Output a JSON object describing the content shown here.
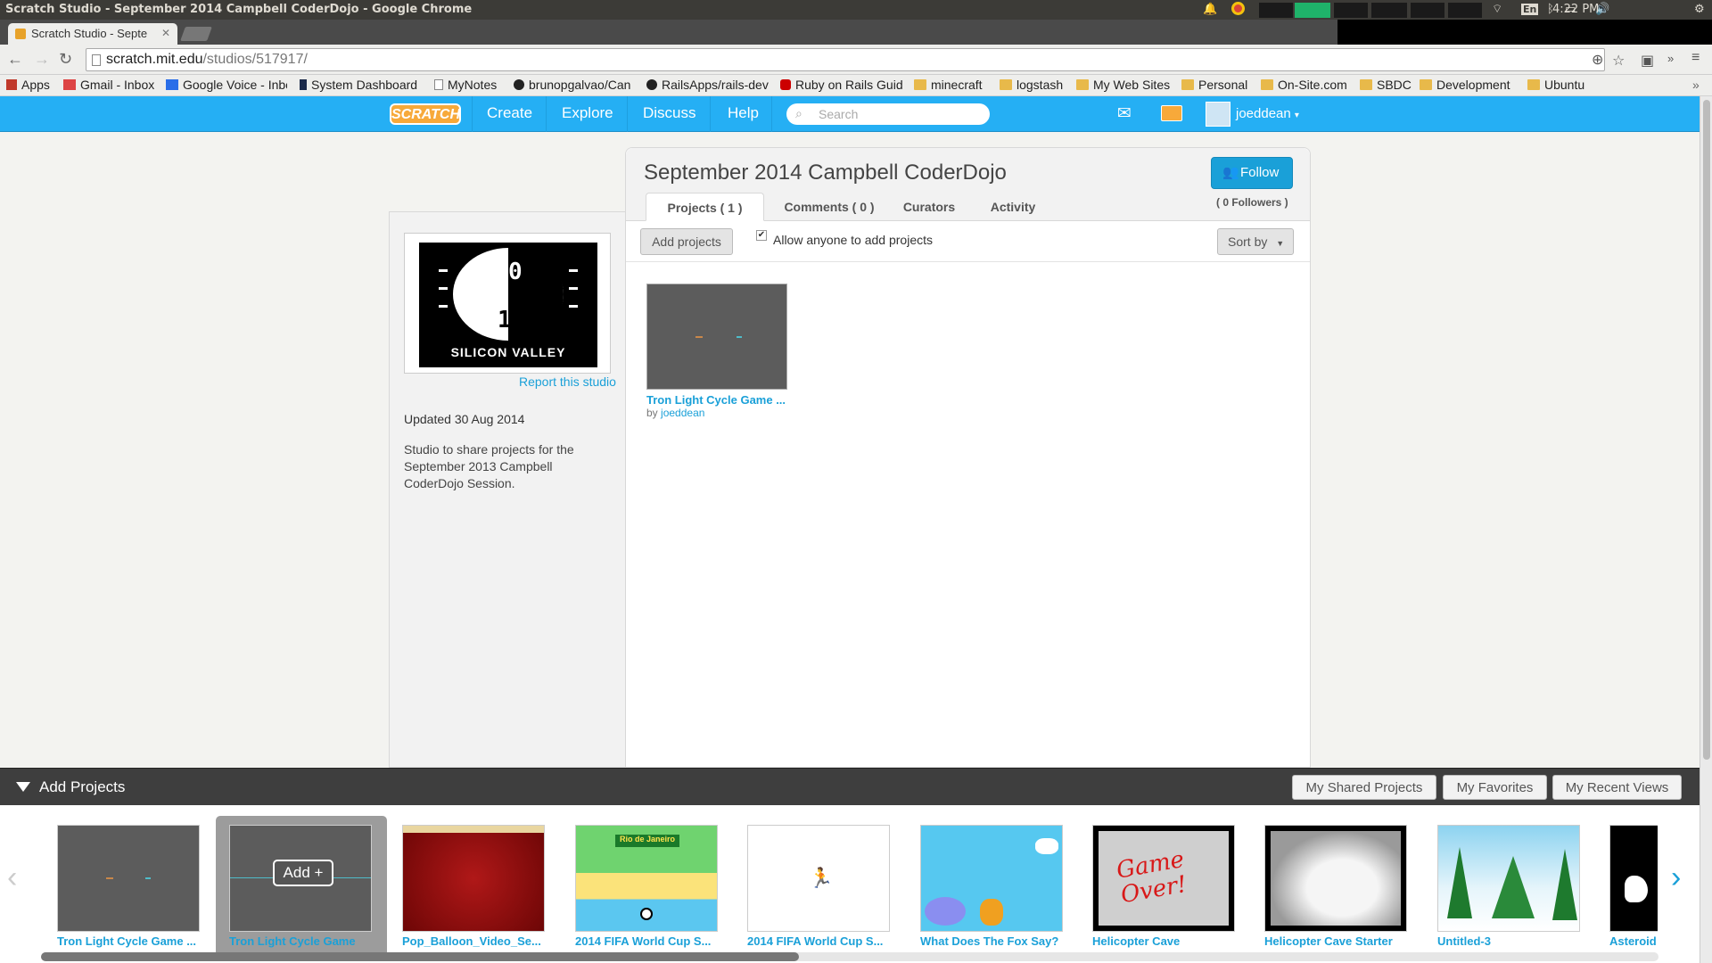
{
  "os": {
    "window_title": "Scratch Studio - September 2014 Campbell CoderDojo - Google Chrome",
    "clock": "4:22 PM",
    "keyboard": "En"
  },
  "browser": {
    "tab_title": "Scratch Studio - Septe",
    "url_host": "scratch.mit.edu",
    "url_path": "/studios/517917/",
    "bookmarks": [
      "Apps",
      "Gmail - Inbox",
      "Google Voice - Inbo",
      "System Dashboard",
      "MyNotes",
      "brunopgalvao/Can",
      "RailsApps/rails-dev",
      "Ruby on Rails Guid",
      "minecraft",
      "logstash",
      "My Web Sites",
      "Personal",
      "On-Site.com",
      "SBDC",
      "Development",
      "Ubuntu"
    ]
  },
  "nav": {
    "logo": "SCRATCH",
    "links": [
      "Create",
      "Explore",
      "Discuss",
      "Help"
    ],
    "search_placeholder": "Search",
    "username": "joeddean"
  },
  "studio": {
    "title": "September 2014 Campbell CoderDojo",
    "follow_label": "Follow",
    "followers": "( 0 Followers )",
    "tabs": [
      "Projects ( 1 )",
      "Comments ( 0 )",
      "Curators",
      "Activity"
    ],
    "add_projects_label": "Add projects",
    "allow_label": "Allow anyone to add projects",
    "allow_checked": true,
    "sort_label": "Sort by",
    "thumb_caption": "SILICON VALLEY",
    "report_label": "Report this studio",
    "updated": "Updated 30 Aug 2014",
    "description": "Studio to share projects for the September 2013 Campbell CoderDojo Session.",
    "project": {
      "title": "Tron Light Cycle Game ...",
      "by": "by",
      "author": "joeddean"
    }
  },
  "drawer": {
    "title": "Add Projects",
    "buttons": [
      "My Shared Projects",
      "My Favorites",
      "My Recent Views"
    ],
    "add_label": "Add +",
    "projects": [
      "Tron Light Cycle Game ...",
      "Tron Light Cycle Game",
      "Pop_Balloon_Video_Se...",
      "2014 FIFA World Cup S...",
      "2014 FIFA World Cup S...",
      "What Does The Fox Say?",
      "Helicopter Cave",
      "Helicopter Cave Starter",
      "Untitled-3",
      "Asteroid"
    ],
    "thumb_texts": {
      "rio": "Rio de Janeiro",
      "game_over": "Game Over!"
    }
  },
  "colors": {
    "scratch_blue": "#25aff4",
    "link_blue": "#1aa0d8",
    "drawer_dark": "#3e3e3e"
  }
}
